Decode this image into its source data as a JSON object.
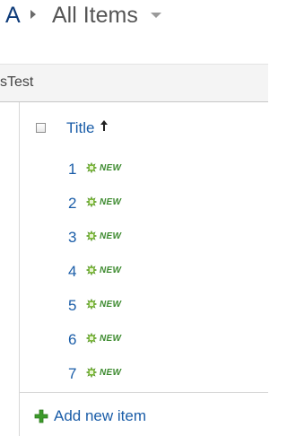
{
  "breadcrumb": {
    "root": "A",
    "current": "All Items"
  },
  "tab": {
    "label": "sTest"
  },
  "list": {
    "column_title": "Title",
    "new_badge": "NEW",
    "rows": [
      "1",
      "2",
      "3",
      "4",
      "5",
      "6",
      "7"
    ]
  },
  "actions": {
    "add_new_item": "Add new item"
  },
  "colors": {
    "link": "#1a5da8",
    "accent_green": "#3c8a2e",
    "crumb_root": "#0f3c7a"
  }
}
